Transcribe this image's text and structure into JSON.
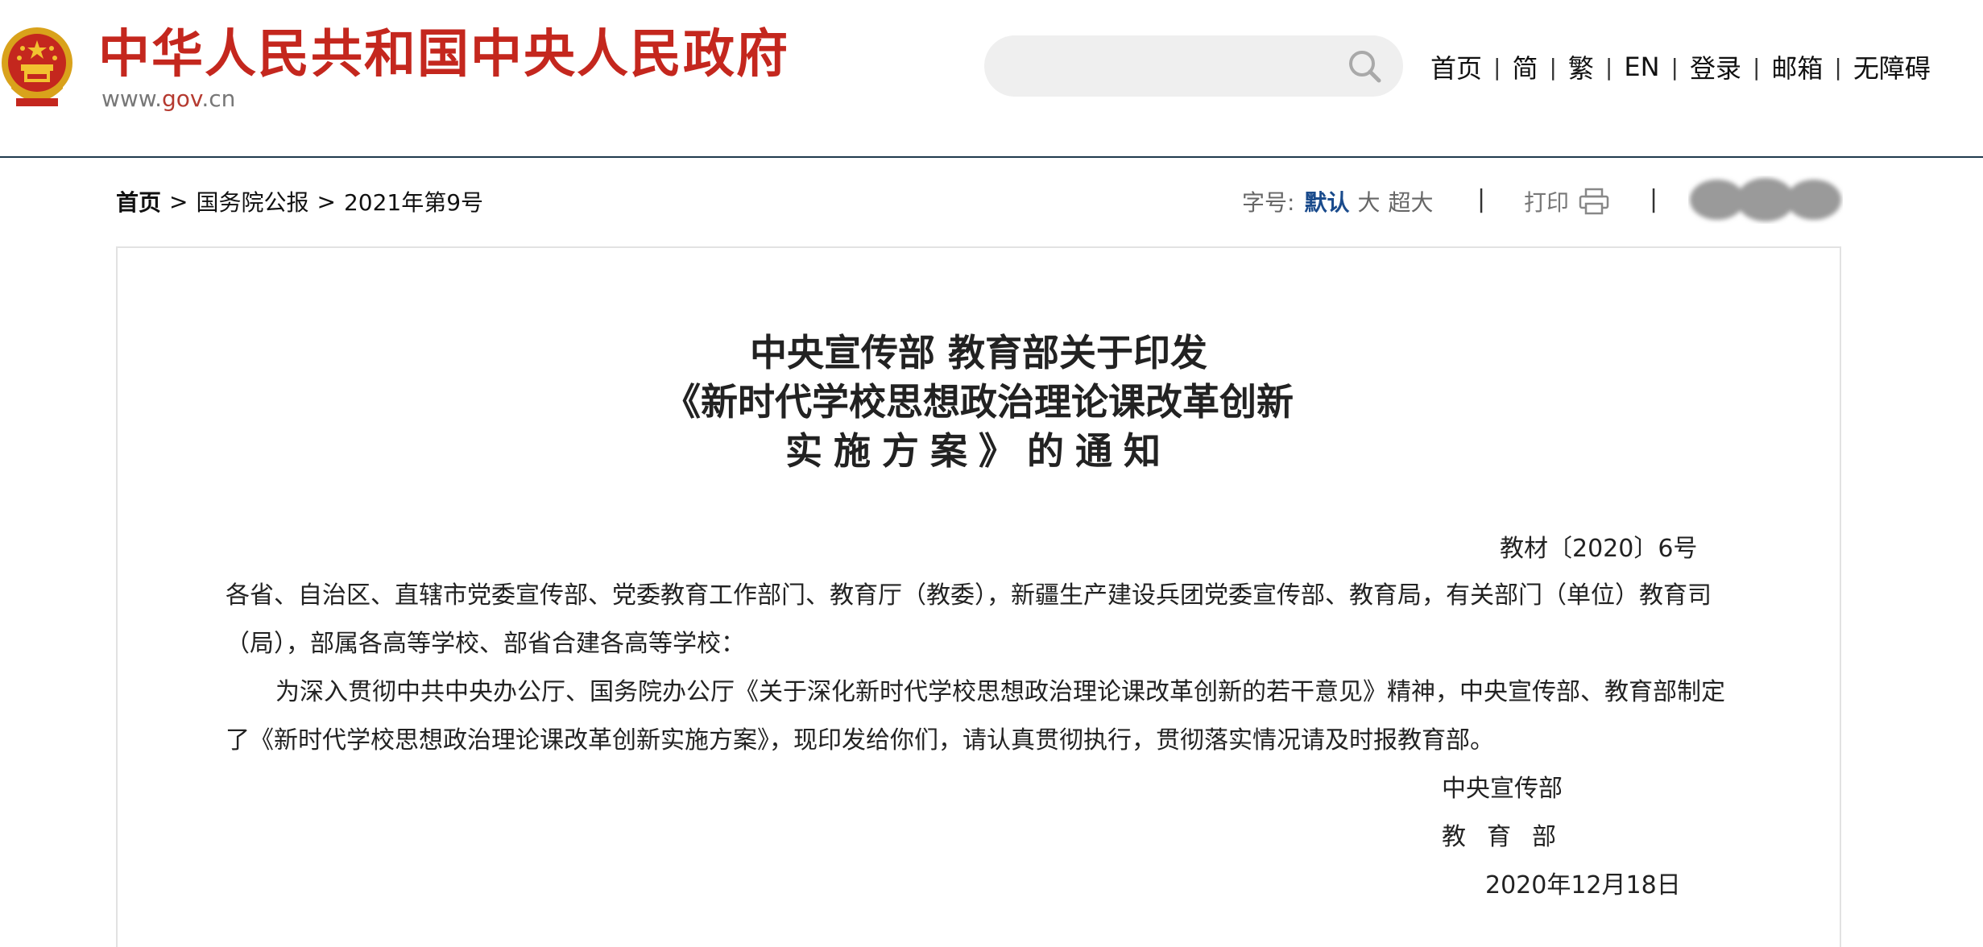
{
  "header": {
    "site_title": "中华人民共和国中央人民政府",
    "site_url_prefix": "www.",
    "site_url_highlight": "gov",
    "site_url_suffix": ".cn",
    "search_placeholder": "",
    "nav": [
      "首页",
      "简",
      "繁",
      "EN",
      "登录",
      "邮箱",
      "无障碍"
    ],
    "nav_separator": "|",
    "brand_color": "#c4271e"
  },
  "toolbar": {
    "breadcrumb": [
      "首页",
      "国务院公报",
      "2021年第9号"
    ],
    "breadcrumb_separator": ">",
    "fontsize_label": "字号:",
    "fontsize_options": [
      "默认",
      "大",
      "超大"
    ],
    "fontsize_active": "默认",
    "divider": "|",
    "print_label": "打印"
  },
  "article": {
    "title_lines": [
      "中央宣传部 教育部关于印发",
      "《新时代学校思想政治理论课改革创新",
      "实施方案》的通知"
    ],
    "doc_number": "教材〔2020〕6号",
    "recipients": "各省、自治区、直辖市党委宣传部、党委教育工作部门、教育厅（教委），新疆生产建设兵团党委宣传部、教育局，有关部门（单位）教育司（局），部属各高等学校、部省合建各高等学校：",
    "body": "为深入贯彻中共中央办公厅、国务院办公厅《关于深化新时代学校思想政治理论课改革创新的若干意见》精神，中央宣传部、教育部制定了《新时代学校思想政治理论课改革创新实施方案》，现印发给你们，请认真贯彻执行，贯彻落实情况请及时报教育部。",
    "signatories": [
      "中央宣传部",
      "教育部"
    ],
    "date": "2020年12月18日"
  }
}
